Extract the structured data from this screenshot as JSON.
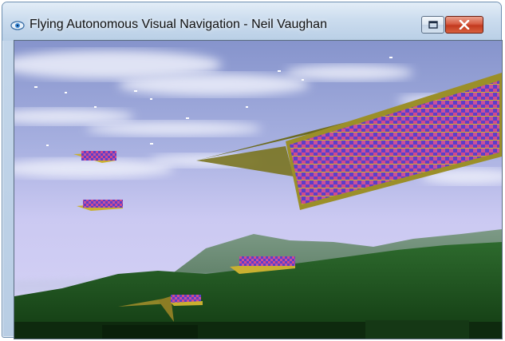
{
  "window": {
    "title": "Flying Autonomous Visual Navigation - Neil Vaughan",
    "app_icon": "eye-icon",
    "controls": {
      "restore_icon": "restore-icon",
      "close_icon": "close-icon"
    }
  },
  "scene": {
    "sky_top": "#8d9ad2",
    "sky_horizon": "#cbc9f2",
    "ground": "#1c4d1c",
    "panel_stripe_colors": [
      "#d14a8e",
      "#5d3ec9",
      "#c9b030"
    ],
    "panel_edge_color": "#7a7420"
  }
}
